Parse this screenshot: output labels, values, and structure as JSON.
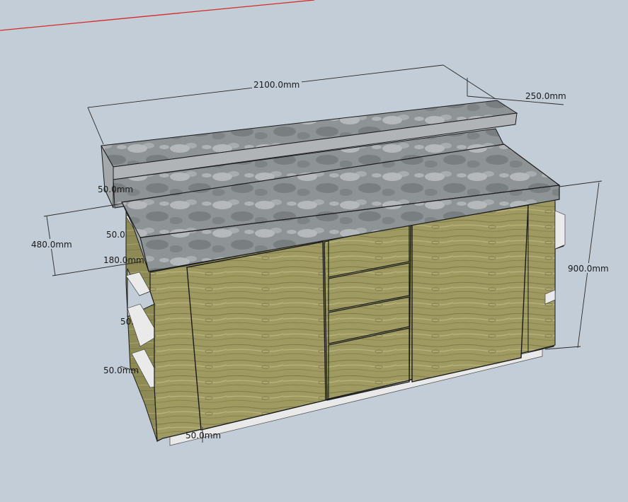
{
  "dimensions": {
    "top_length": "2100.0mm",
    "top_depth": "250.0mm",
    "top_thickness": "50.0mm",
    "height_480": "480.0mm",
    "side_50_a": "50.0",
    "side_180": "180.0mm",
    "side_50_b": "50.",
    "side_50_c": "50.0mm",
    "base_50": "50.0mm",
    "total_height": "900.0mm"
  },
  "colors": {
    "background": "#c3cdd7",
    "axis_red": "#d42a2a",
    "concrete": "#8e9396",
    "wood": "#9e9a62",
    "metal_base": "#e9e9ea"
  }
}
